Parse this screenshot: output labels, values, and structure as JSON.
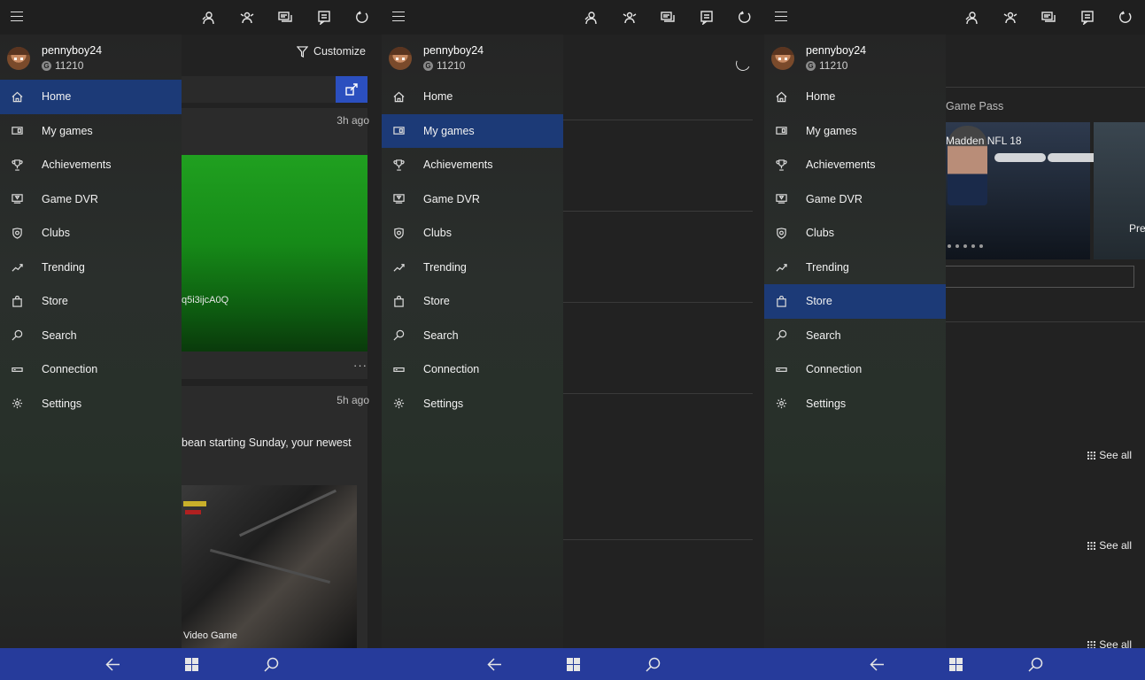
{
  "user": {
    "gamertag": "pennyboy24",
    "gamerscore": "11210",
    "gamerscore_badge": "G"
  },
  "nav_items": [
    {
      "label": "Home",
      "icon": "home-icon"
    },
    {
      "label": "My games",
      "icon": "my-games-icon"
    },
    {
      "label": "Achievements",
      "icon": "trophy-icon"
    },
    {
      "label": "Game DVR",
      "icon": "game-dvr-icon"
    },
    {
      "label": "Clubs",
      "icon": "clubs-shield-icon"
    },
    {
      "label": "Trending",
      "icon": "trending-icon"
    },
    {
      "label": "Store",
      "icon": "store-bag-icon"
    },
    {
      "label": "Search",
      "icon": "search-icon"
    },
    {
      "label": "Connection",
      "icon": "connection-icon"
    },
    {
      "label": "Settings",
      "icon": "settings-gear-icon"
    }
  ],
  "panels": [
    {
      "active_nav": "Home"
    },
    {
      "active_nav": "My games"
    },
    {
      "active_nav": "Store"
    }
  ],
  "topbar_icons": [
    "friends-icon",
    "party-icon",
    "messages-icon",
    "activity-feed-icon",
    "refresh-icon"
  ],
  "home_feed": {
    "customize_label": "Customize",
    "post1_time": "3h ago",
    "post1_code": "q5i3ijcA0Q",
    "post1_more": "···",
    "post2_time": "5h ago",
    "post2_text": "bean starting Sunday, your newest",
    "post2_caption": "Video Game"
  },
  "store": {
    "section_title": "Game Pass",
    "tile1_title": "Madden NFL 18",
    "tile2_title": "Pre-",
    "see_all_label": "See all"
  },
  "taskbar": {
    "back_icon": "back-arrow-icon",
    "windows_icon": "windows-logo-icon",
    "search_icon": "search-icon"
  },
  "colors": {
    "accent": "#1c3a77",
    "taskbar": "#263b9b",
    "share_button": "#2b4fbf",
    "green_tile": "#168a18"
  }
}
